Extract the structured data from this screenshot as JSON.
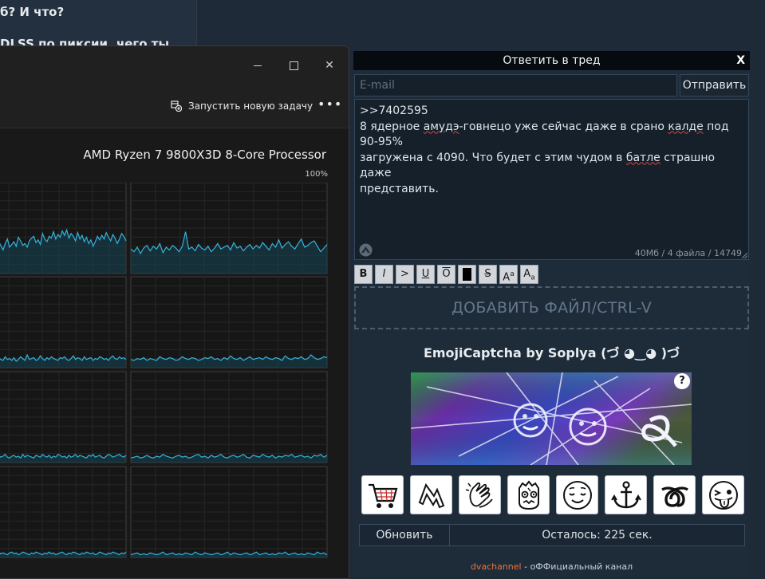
{
  "forum_bg": {
    "line1": "б? И что?",
    "line2": "DLSS по пиксии, чего ты"
  },
  "task_manager": {
    "controls": {
      "minimize": "—",
      "maximize": "□",
      "close": "✕"
    },
    "new_task_label": "Запустить новую задачу",
    "more_label": "•••",
    "cpu_name": "AMD Ryzen 7 9800X3D 8-Core Processor",
    "scale_max": "100%",
    "cpu_graphs": [
      {
        "values": [
          30,
          33,
          28,
          35,
          31,
          26,
          33,
          38,
          29,
          32,
          35,
          30,
          40,
          36,
          31,
          33,
          29,
          36,
          39,
          41,
          34,
          37,
          32,
          44,
          38,
          35,
          41,
          39,
          46,
          38,
          43,
          40,
          47,
          42,
          48,
          39,
          44,
          41,
          36,
          45,
          38,
          42,
          35,
          40,
          33,
          37,
          30,
          35,
          41,
          37,
          42,
          38,
          45,
          40,
          36,
          43,
          39,
          33,
          38,
          44,
          41,
          36
        ]
      },
      {
        "values": [
          27,
          24,
          29,
          22,
          28,
          31,
          25,
          30,
          27,
          33,
          23,
          29,
          26,
          31,
          28,
          24,
          30,
          46,
          27,
          29,
          25,
          32,
          28,
          26,
          30,
          24,
          28,
          33,
          27,
          29,
          31,
          26,
          34,
          28,
          30,
          25,
          29,
          32,
          27,
          31,
          28,
          34,
          30,
          26,
          33,
          29,
          37,
          28,
          32,
          35,
          30,
          27,
          33,
          38,
          29,
          31,
          34,
          36,
          30,
          24,
          28,
          32
        ]
      },
      {
        "values": [
          8,
          10,
          7,
          11,
          9,
          8,
          12,
          9,
          10,
          8,
          11,
          7,
          9,
          12,
          10,
          8,
          14,
          9,
          10,
          11,
          8,
          9,
          13,
          10,
          8,
          11,
          9,
          12,
          10,
          9,
          8,
          11,
          10,
          12,
          9,
          8,
          10,
          13,
          9,
          11,
          10,
          8,
          12,
          9,
          10,
          11,
          8,
          10,
          9,
          12,
          11,
          9,
          10,
          8,
          11,
          13,
          10,
          9,
          12,
          10,
          11,
          9
        ]
      },
      {
        "values": [
          9,
          8,
          10,
          9,
          11,
          8,
          10,
          9,
          8,
          12,
          10,
          9,
          11,
          10,
          8,
          9,
          12,
          10,
          9,
          11,
          10,
          8,
          9,
          11,
          10,
          12,
          9,
          10,
          8,
          11,
          9,
          13,
          10,
          9,
          11,
          8,
          10,
          12,
          9,
          10,
          11,
          9,
          12,
          10,
          9,
          11,
          10,
          8,
          13,
          10,
          9,
          11,
          10,
          12,
          9,
          10,
          14,
          11,
          9,
          10,
          12,
          11
        ]
      },
      {
        "values": [
          6,
          7,
          5,
          8,
          6,
          7,
          9,
          6,
          5,
          7,
          8,
          6,
          7,
          5,
          9,
          6,
          8,
          7,
          6,
          5,
          8,
          7,
          6,
          9,
          7,
          6,
          8,
          5,
          7,
          6,
          9,
          8,
          6,
          7,
          5,
          8,
          6,
          7,
          9,
          6,
          8,
          7,
          6,
          5,
          8,
          7,
          9,
          6,
          7,
          8,
          6,
          5,
          7,
          9,
          8,
          6,
          7,
          8,
          9,
          7,
          6,
          8
        ]
      },
      {
        "values": [
          5,
          6,
          7,
          5,
          6,
          8,
          6,
          5,
          7,
          6,
          9,
          7,
          6,
          5,
          7,
          8,
          6,
          7,
          5,
          6,
          8,
          9,
          6,
          7,
          5,
          8,
          6,
          7,
          9,
          6,
          5,
          7,
          8,
          6,
          7,
          9,
          6,
          5,
          8,
          7,
          6,
          9,
          7,
          6,
          8,
          5,
          7,
          6,
          8,
          7,
          9,
          6,
          7,
          8,
          6,
          7,
          5,
          8,
          7,
          9,
          6,
          8
        ]
      },
      {
        "values": [
          4,
          5,
          3,
          6,
          4,
          5,
          4,
          3,
          5,
          6,
          4,
          5,
          3,
          4,
          6,
          5,
          4,
          3,
          5,
          4,
          6,
          5,
          4,
          3,
          5,
          4,
          6,
          4,
          5,
          3,
          4,
          5,
          6,
          4,
          3,
          5,
          4,
          6,
          5,
          4,
          3,
          5,
          4,
          6,
          5,
          4,
          5,
          3,
          4,
          6,
          5,
          4,
          3,
          5,
          4,
          6,
          5,
          4,
          3,
          5,
          4,
          6
        ]
      },
      {
        "values": [
          3,
          4,
          5,
          3,
          4,
          3,
          5,
          4,
          3,
          4,
          6,
          3,
          4,
          5,
          3,
          4,
          3,
          5,
          4,
          3,
          6,
          4,
          3,
          5,
          4,
          3,
          4,
          5,
          3,
          4,
          6,
          3,
          5,
          4,
          3,
          4,
          5,
          3,
          4,
          6,
          3,
          4,
          5,
          3,
          4,
          3,
          5,
          4,
          6,
          3,
          4,
          5,
          3,
          4,
          3,
          5,
          4,
          3,
          6,
          4,
          5,
          3
        ]
      }
    ]
  },
  "reply_form": {
    "header": "Ответить в тред",
    "close_label": "X",
    "email_placeholder": "E-mail",
    "send_label": "Отправить",
    "message": {
      "line1": ">>7402595",
      "line2_a": "8 ядерное ",
      "line2_sp1": "амудэ",
      "line2_b": "-говнецо уже сейчас даже в срано ",
      "line2_sp2": "калде",
      "line2_c": " под 90-95%",
      "line3_a": "загружена с 4090. Что будет с этим чудом в ",
      "line3_sp": "батле",
      "line3_b": " страшно даже",
      "line4": "представить."
    },
    "counter": "40Мб / 4 файла / 14749",
    "format_buttons": [
      {
        "name": "bold-button",
        "label": "B",
        "cls": "b"
      },
      {
        "name": "italic-button",
        "label": "I",
        "cls": "i"
      },
      {
        "name": "quote-button",
        "label": ">",
        "cls": ""
      },
      {
        "name": "underline-button",
        "label": "U",
        "cls": "u"
      },
      {
        "name": "overline-button",
        "label": "O",
        "cls": "o"
      },
      {
        "name": "spoiler-button",
        "label": "",
        "cls": "spoiler"
      },
      {
        "name": "strike-button",
        "label": "S",
        "cls": "s"
      },
      {
        "name": "superscript-button",
        "label": "A",
        "sup": "a",
        "cls": "sup"
      },
      {
        "name": "subscript-button",
        "label": "A",
        "sub": "a",
        "cls": "sub"
      }
    ],
    "dropzone_label": "ДОБАВИТЬ ФАЙЛ/CTRL-V",
    "captcha_title": "EmojiCaptcha by Soplya (づ ◕‿◕ )づ",
    "captcha_help": "?",
    "emoji_options": [
      "shopping-cart-icon",
      "zigzag-arrow-icon",
      "clapping-hands-icon",
      "zombie-face-icon",
      "relieved-face-icon",
      "anchor-icon",
      "loop-symbol-icon",
      "tongue-out-face-icon"
    ],
    "refresh_label": "Обновить",
    "remaining_label": "Осталось: 225 сек.",
    "footer_channel": "dvachannel",
    "footer_rest": " - оФФициальный канал"
  }
}
